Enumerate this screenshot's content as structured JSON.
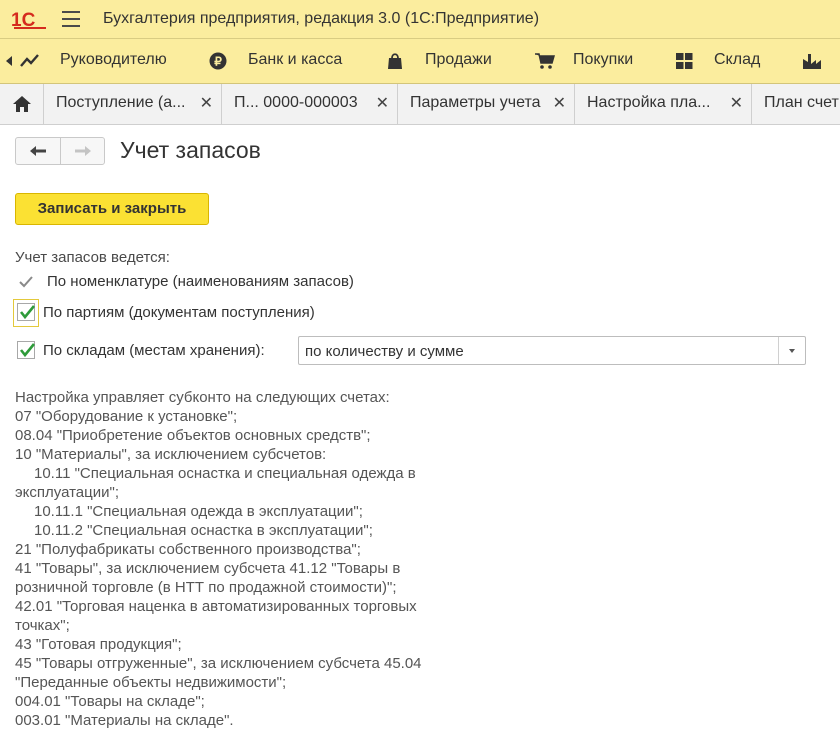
{
  "app": {
    "title": "Бухгалтерия предприятия, редакция 3.0  (1С:Предприятие)",
    "brand_color": "#fbed9e",
    "accent_color": "#fbe133",
    "logo_color": "#d52b1e"
  },
  "sections": {
    "items": [
      {
        "label": "Руководителю",
        "icon": "trend-chart-icon"
      },
      {
        "label": "Банк и касса",
        "icon": "ruble-coin-icon"
      },
      {
        "label": "Продажи",
        "icon": "shopping-bag-icon"
      },
      {
        "label": "Покупки",
        "icon": "shopping-cart-icon"
      },
      {
        "label": "Склад",
        "icon": "warehouse-grid-icon"
      }
    ]
  },
  "tabs": [
    {
      "label": "Поступление (а..."
    },
    {
      "label": "П...   0000-000003"
    },
    {
      "label": "Параметры учета"
    },
    {
      "label": "Настройка пла..."
    },
    {
      "label": "План счет"
    }
  ],
  "form": {
    "title": "Учет запасов",
    "save_label": "Записать и закрыть",
    "intro_label": "Учет запасов ведется:",
    "options": [
      {
        "label": "По номенклатуре (наименованиям запасов)",
        "checked": true
      },
      {
        "label": "По партиям (документам поступления)",
        "checked": true
      },
      {
        "label": "По складам (местам хранения):",
        "checked": true
      }
    ],
    "warehouse_mode": "по количеству и сумме",
    "info_lines": [
      "Настройка управляет субконто на следующих счетах:",
      "07 \"Оборудование к установке\";",
      "08.04 \"Приобретение объектов основных средств\";",
      "10 \"Материалы\", за исключением субсчетов:",
      "10.11 \"Специальная оснастка и специальная одежда в",
      "эксплуатации\";",
      "10.11.1 \"Специальная одежда в эксплуатации\";",
      "10.11.2 \"Специальная оснастка в эксплуатации\";",
      "21 \"Полуфабрикаты собственного производства\";",
      "41 \"Товары\", за исключением субсчета 41.12 \"Товары в",
      "розничной торговле (в НТТ по продажной стоимости)\";",
      "42.01 \"Торговая наценка в автоматизированных торговых",
      "точках\";",
      "43 \"Готовая продукция\";",
      "45 \"Товары отгруженные\", за исключением субсчета 45.04",
      "\"Переданные объекты недвижимости\";",
      "004.01 \"Товары на складе\";",
      "003.01 \"Материалы на складе\"."
    ]
  }
}
